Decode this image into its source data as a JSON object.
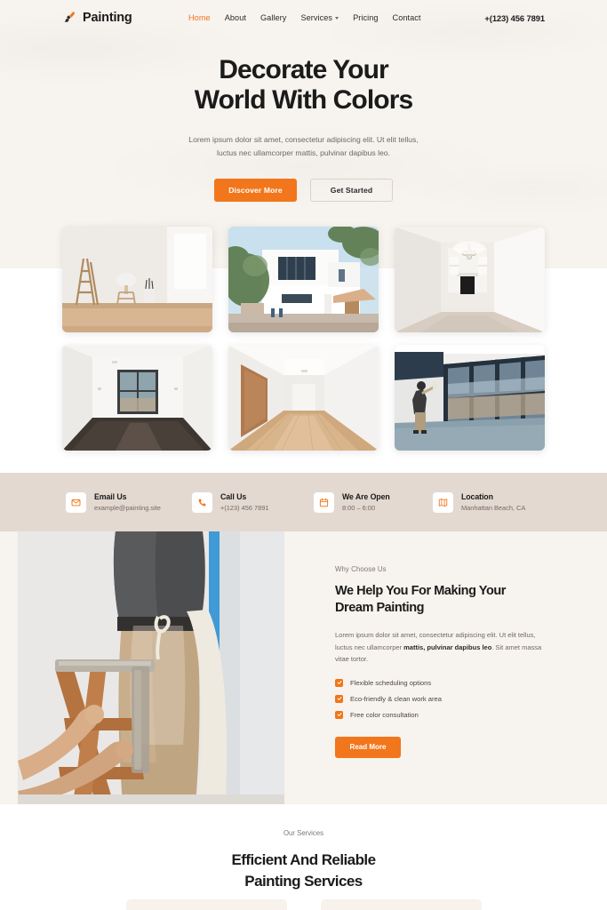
{
  "nav": {
    "brand": "Painting",
    "brand_icon": "paint-brush-icon",
    "links": [
      {
        "label": "Home",
        "active": true
      },
      {
        "label": "About",
        "active": false
      },
      {
        "label": "Gallery",
        "active": false
      },
      {
        "label": "Services",
        "active": false,
        "has_dropdown": true
      },
      {
        "label": "Pricing",
        "active": false
      },
      {
        "label": "Contact",
        "active": false
      }
    ],
    "phone": "+(123) 456 7891"
  },
  "hero": {
    "title_line1": "Decorate Your",
    "title_line2": "World With Colors",
    "subtitle": "Lorem ipsum dolor sit amet, consectetur adipiscing elit. Ut elit tellus, luctus nec ullamcorper mattis, pulvinar dapibus leo.",
    "primary_button": "Discover More",
    "secondary_button": "Get Started"
  },
  "gallery": {
    "images": [
      {
        "alt": "empty white room with wooden ladder stool and plant"
      },
      {
        "alt": "modern white two story house exterior with trees"
      },
      {
        "alt": "empty living room with fireplace and chandelier"
      },
      {
        "alt": "empty room with dark hardwood floor and large window"
      },
      {
        "alt": "white hallway with wooden floor and wooden door"
      },
      {
        "alt": "worker painting wall beside glass sliding doors"
      }
    ]
  },
  "infobar": {
    "items": [
      {
        "icon": "envelope-icon",
        "title": "Email Us",
        "desc": "example@painting.site"
      },
      {
        "icon": "phone-icon",
        "title": "Call Us",
        "desc": "+(123) 456 7891"
      },
      {
        "icon": "calendar-icon",
        "title": "We Are Open",
        "desc": "8:00 – 6:00"
      },
      {
        "icon": "map-icon",
        "title": "Location",
        "desc": "Manhattan Beach, CA"
      }
    ]
  },
  "why": {
    "photo_alt": "painter on wooden ladder wearing apron next to blue painted stripe",
    "eyebrow": "Why Choose Us",
    "heading_line1": "We Help You For Making Your",
    "heading_line2": "Dream Painting",
    "body_before": "Lorem ipsum dolor sit amet, consectetur adipiscing elit. Ut elit tellus, luctus nec ullamcorper ",
    "body_bold": "mattis, pulvinar dapibus leo",
    "body_after": ". Sit amet massa vitae tortor.",
    "features": [
      "Flexible scheduling options",
      "Eco-friendly & clean work area",
      "Free color consultation"
    ],
    "button": "Read More"
  },
  "services": {
    "eyebrow": "Our Services",
    "heading_line1": "Efficient And Reliable",
    "heading_line2": "Painting Services"
  },
  "colors": {
    "accent": "#f2761b",
    "hero_bg": "#f7f3ee",
    "infobar_bg": "#e3d9d1",
    "text_dark": "#1b1b1b",
    "text_muted": "#6f6862"
  }
}
